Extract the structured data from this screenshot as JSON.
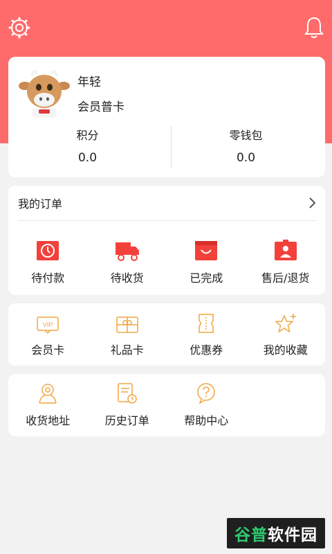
{
  "profile": {
    "username": "年轻",
    "level": "会员普卡",
    "points_label": "积分",
    "points_value": "0.0",
    "wallet_label": "零钱包",
    "wallet_value": "0.0"
  },
  "orders": {
    "title": "我的订单",
    "items": [
      {
        "label": "待付款",
        "icon": "clock-icon"
      },
      {
        "label": "待收货",
        "icon": "truck-icon"
      },
      {
        "label": "已完成",
        "icon": "smile-box-icon"
      },
      {
        "label": "售后/退货",
        "icon": "service-badge-icon"
      }
    ]
  },
  "services": {
    "items": [
      {
        "label": "会员卡",
        "icon": "vip-card-icon"
      },
      {
        "label": "礼品卡",
        "icon": "gift-card-icon"
      },
      {
        "label": "优惠券",
        "icon": "coupon-icon"
      },
      {
        "label": "我的收藏",
        "icon": "star-icon"
      }
    ]
  },
  "tools": {
    "items": [
      {
        "label": "收货地址",
        "icon": "address-icon"
      },
      {
        "label": "历史订单",
        "icon": "history-order-icon"
      },
      {
        "label": "帮助中心",
        "icon": "help-icon"
      }
    ]
  },
  "watermark": {
    "part1": "谷普",
    "part2": "软件园"
  },
  "colors": {
    "header": "#ff6a6a",
    "red_icon": "#f2413b",
    "orange_icon": "#f0a640"
  }
}
